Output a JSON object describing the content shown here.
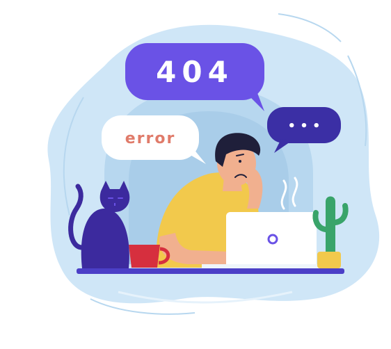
{
  "illustration": {
    "code_bubble": {
      "text": "404"
    },
    "error_bubble": {
      "text": "error"
    },
    "typing_bubble": {
      "text": "• • •"
    }
  },
  "colors": {
    "blob": "#cfe6f7",
    "blob_light": "#e6f2fb",
    "window": "#b7d7ef",
    "purple": "#6a52e6",
    "dark_purple": "#3b2fa5",
    "error_text": "#e07b6a",
    "shirt": "#f2c94c",
    "skin": "#f1b08f",
    "hair": "#1f1f3a",
    "cat": "#3c2a9e",
    "mug": "#d62f3e",
    "laptop": "#ffffff",
    "plant": "#39a46a",
    "pot": "#f2c94c",
    "desk": "#4b3fc7"
  }
}
